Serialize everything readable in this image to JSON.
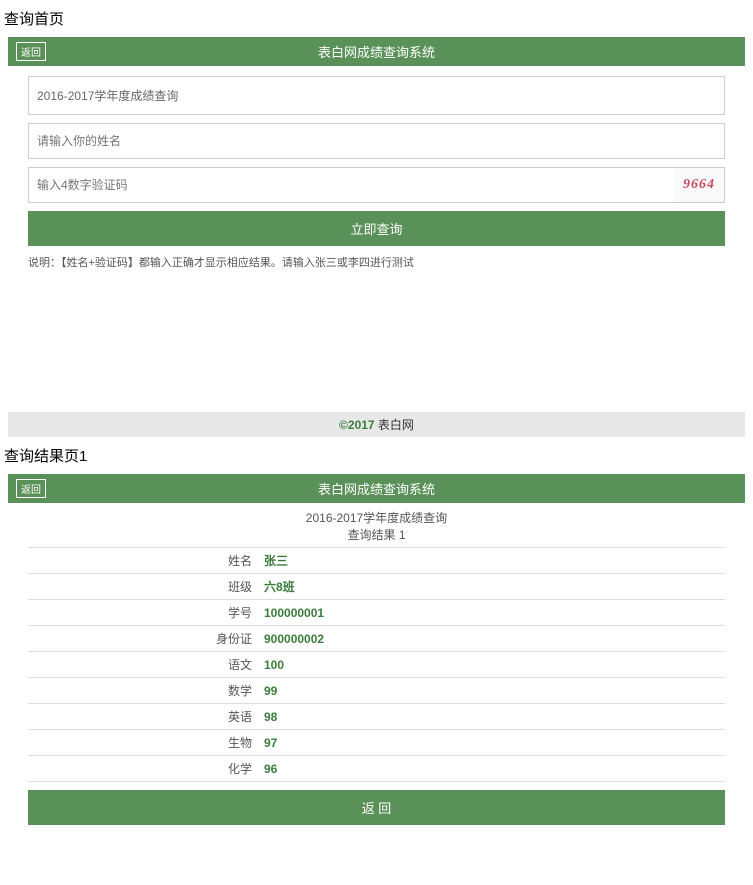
{
  "page1": {
    "sectionTitle": "查询首页",
    "backBtn": "返回",
    "headerTitle": "表白网成绩查询系统",
    "yearLabel": "2016-2017学年度成绩查询",
    "namePlaceholder": "请输入你的姓名",
    "captchaPlaceholder": "输入4数字验证码",
    "captchaValue": "9664",
    "submitLabel": "立即查询",
    "noteText": "说明：【姓名+验证码】都输入正确才显示相应结果。请输入张三或李四进行测试"
  },
  "footer": {
    "copy": "©2017 ",
    "site": "表白网"
  },
  "page2": {
    "sectionTitle": "查询结果页1",
    "backBtn": "返回",
    "headerTitle": "表白网成绩查询系统",
    "resultTitle": "2016-2017学年度成绩查询",
    "resultSub": "查询结果 1",
    "rows": [
      {
        "label": "姓名",
        "value": "张三"
      },
      {
        "label": "班级",
        "value": "六8班"
      },
      {
        "label": "学号",
        "value": "100000001"
      },
      {
        "label": "身份证",
        "value": "900000002"
      },
      {
        "label": "语文",
        "value": "100"
      },
      {
        "label": "数学",
        "value": "99"
      },
      {
        "label": "英语",
        "value": "98"
      },
      {
        "label": "生物",
        "value": "97"
      },
      {
        "label": "化学",
        "value": "96"
      }
    ],
    "returnLabel": "返 回"
  }
}
